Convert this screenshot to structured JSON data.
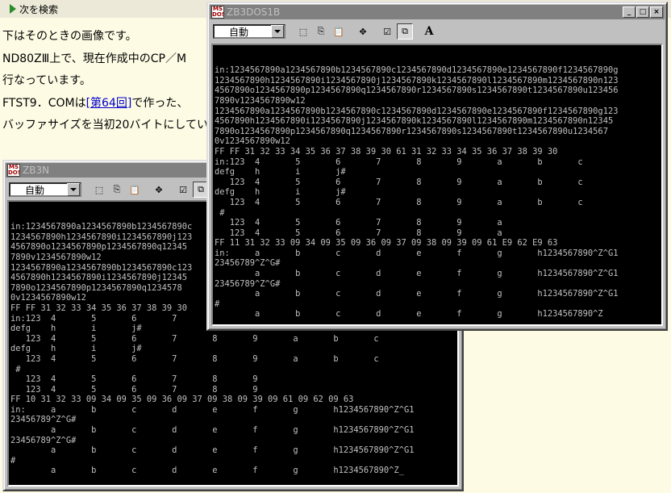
{
  "toolbar": {
    "find_next": "次を検索"
  },
  "page": {
    "lines": [
      "下はそのときの画像です。",
      "ND80ZⅢ上で、現在作成中のCP／M",
      "行なっています。",
      "FTST9．COMは",
      "バッファサイズを当初20バイトにしてい"
    ],
    "link": "[第64回]",
    "after_link": "で作った、"
  },
  "win_back": {
    "title": "ZB3N",
    "font_select": "自動",
    "lines": [
      "in:1234567890a1234567890b1234567890c",
      "1234567890h1234567890i1234567890j123",
      "4567890o1234567890p1234567890q12345",
      "7890v1234567890w12",
      "1234567890a1234567890b1234567890c123",
      "4567890h1234567890i1234567890j12345",
      "7890o1234567890p1234567890q1234578",
      "0v1234567890w12",
      "FF FF 31 32 33 34 35 36 37 38 39 30",
      "in:123  4       5       6       7",
      "defg    h       i       j#",
      "   123  4       5       6       7       8       9       a       b       c",
      "defg    h       i       j#",
      "   123  4       5       6       7       8       9       a       b       c",
      " #",
      "   123  4       5       6       7       8       9",
      "   123  4       5       6       7       8       9",
      "FF 10 31 32 33 09 34 09 35 09 36 09 37 09 38 09 39 09 61 09 62 09 63",
      "in:     a       b       c       d       e       f       g       h1234567890^Z^G1",
      "23456789^Z^G#",
      "        a       b       c       d       e       f       g       h1234567890^Z^G1",
      "23456789^Z^G#",
      "        a       b       c       d       e       f       g       h1234567890^Z^G1",
      "#",
      "        a       b       c       d       e       f       g       h1234567890^Z_"
    ]
  },
  "win_front": {
    "title": "ZB3DOS1B",
    "font_select": "自動",
    "lines": [
      "in:1234567890a1234567890b1234567890c1234567890d1234567890e1234567890f1234567890g",
      "1234567890h1234567890i1234567890j1234567890k1234567890l1234567890m1234567890n123",
      "4567890o1234567890p1234567890q1234567890r1234567890s1234567890t1234567890u123456",
      "7890v1234567890w12",
      "1234567890a1234567890b1234567890c1234567890d1234567890e1234567890f1234567890g123",
      "4567890h1234567890i1234567890j1234567890k1234567890l1234567890m1234567890n12345",
      "7890o1234567890p1234567890q1234567890r1234567890s1234567890t1234567890u1234567",
      "0v1234567890w12",
      "FF FF 31 32 33 34 35 36 37 38 39 30 61 31 32 33 34 35 36 37 38 39 30",
      "in:123  4       5       6       7       8       9       a       b       c",
      "defg    h       i       j#",
      "   123  4       5       6       7       8       9       a       b       c",
      "defg    h       i       j#",
      "   123  4       5       6       7       8       9       a       b       c",
      " #",
      "   123  4       5       6       7       8       9       a",
      "   123  4       5       6       7       8       9       a",
      "FF 11 31 32 33 09 34 09 35 09 36 09 37 09 38 09 39 09 61 E9 62 E9 63",
      "in:     a       b       c       d       e       f       g       h1234567890^Z^G1",
      "23456789^Z^G#",
      "        a       b       c       d       e       f       g       h1234567890^Z^G1",
      "23456789^Z^G#",
      "        a       b       c       d       e       f       g       h1234567890^Z^G1",
      "#",
      "        a       b       c       d       e       f       g       h1234567890^Z"
    ]
  }
}
